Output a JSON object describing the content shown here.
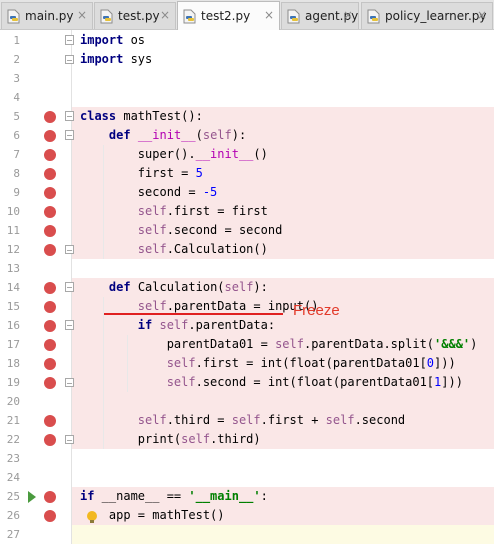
{
  "tabs": [
    {
      "label": "main.py",
      "active": false
    },
    {
      "label": "test.py",
      "active": false
    },
    {
      "label": "test2.py",
      "active": true
    },
    {
      "label": "agent.py",
      "active": false
    },
    {
      "label": "policy_learner.py",
      "active": false
    }
  ],
  "close_glyph": "×",
  "annotation": "Freeze",
  "lines": [
    {
      "n": "1",
      "html": "<span class='kw'>import</span> os"
    },
    {
      "n": "2",
      "html": "<span class='kw'>import</span> sys"
    },
    {
      "n": "3",
      "html": ""
    },
    {
      "n": "4",
      "html": ""
    },
    {
      "n": "5",
      "html": "<span class='kw'>class</span> mathTest():"
    },
    {
      "n": "6",
      "html": "    <span class='kw'>def</span> <span class='dunder'>__init__</span>(<span class='self'>self</span>):"
    },
    {
      "n": "7",
      "html": "        super().<span class='dunder'>__init__</span>()"
    },
    {
      "n": "8",
      "html": "        first = <span class='num'>5</span>"
    },
    {
      "n": "9",
      "html": "        second = <span class='num'>-5</span>"
    },
    {
      "n": "10",
      "html": "        <span class='self'>self</span>.first = first"
    },
    {
      "n": "11",
      "html": "        <span class='self'>self</span>.second = second"
    },
    {
      "n": "12",
      "html": "        <span class='self'>self</span>.Calculation()"
    },
    {
      "n": "13",
      "html": ""
    },
    {
      "n": "14",
      "html": "    <span class='kw'>def</span> Calculation(<span class='self'>self</span>):"
    },
    {
      "n": "15",
      "html": "        <span class='self'>self</span>.parentData = input()"
    },
    {
      "n": "16",
      "html": "        <span class='kw'>if</span> <span class='self'>self</span>.parentData:"
    },
    {
      "n": "17",
      "html": "            parentData01 = <span class='self'>self</span>.parentData.split(<span class='str'>'&amp;&amp;&amp;'</span>)"
    },
    {
      "n": "18",
      "html": "            <span class='self'>self</span>.first = int(float(parentData01[<span class='num'>0</span>]))"
    },
    {
      "n": "19",
      "html": "            <span class='self'>self</span>.second = int(float(parentData01[<span class='num'>1</span>]))"
    },
    {
      "n": "20",
      "html": ""
    },
    {
      "n": "21",
      "html": "        <span class='self'>self</span>.third = <span class='self'>self</span>.first + <span class='self'>self</span>.second"
    },
    {
      "n": "22",
      "html": "        print(<span class='self'>self</span>.third)"
    },
    {
      "n": "23",
      "html": ""
    },
    {
      "n": "24",
      "html": ""
    },
    {
      "n": "25",
      "html": "<span class='kw'>if</span> __name__ == <span class='str'>'__main__'</span>:"
    },
    {
      "n": "26",
      "html": "    app = mathTest()"
    },
    {
      "n": "27",
      "html": ""
    }
  ]
}
